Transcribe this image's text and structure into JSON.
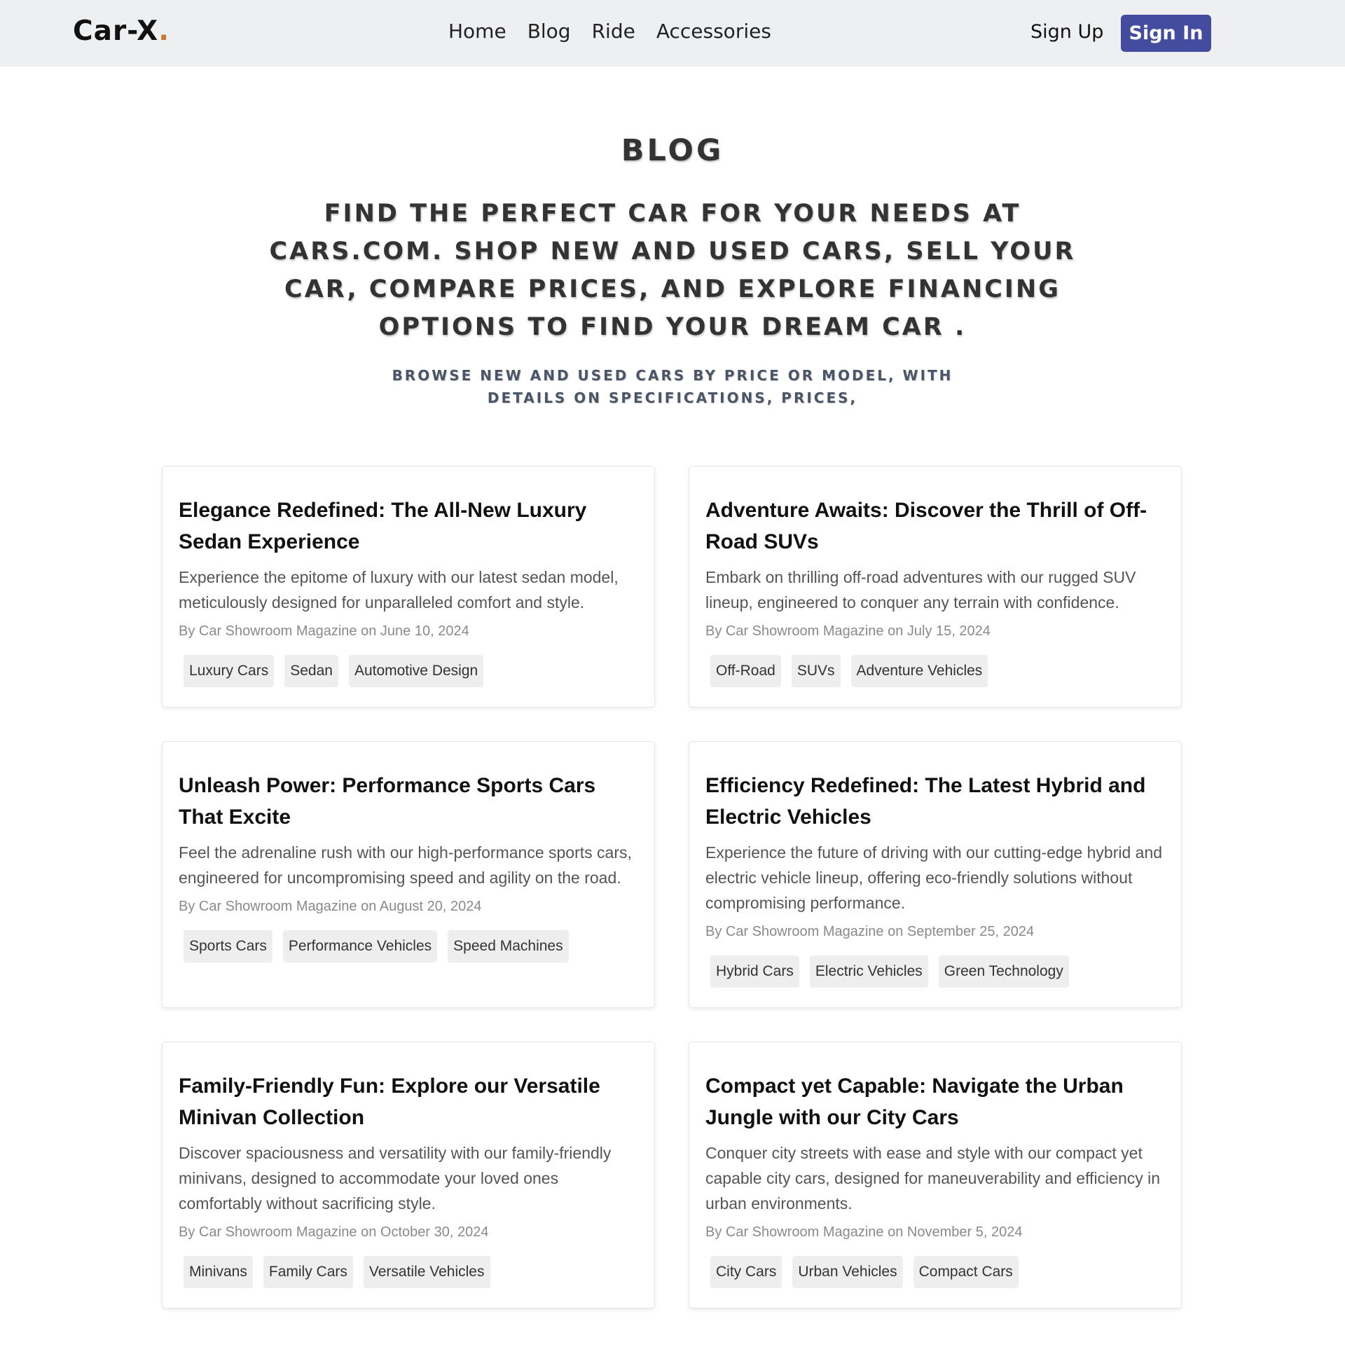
{
  "navbar": {
    "logo_text": "Car-X",
    "logo_dot": ".",
    "links": [
      "Home",
      "Blog",
      "Ride",
      "Accessories"
    ],
    "sign_up": "Sign Up",
    "sign_in": "Sign In"
  },
  "colors": {
    "accent": "#434c9e",
    "logo_dot": "#c8782f",
    "navbar_bg": "#eeeff1"
  },
  "hero": {
    "title": "BLOG",
    "subtitle": "FIND THE PERFECT CAR FOR YOUR NEEDS AT CARS.COM. SHOP NEW AND USED CARS, SELL YOUR CAR, COMPARE PRICES, AND EXPLORE FINANCING OPTIONS TO FIND YOUR DREAM CAR .",
    "small": "BROWSE NEW AND USED CARS BY PRICE OR MODEL, WITH DETAILS ON SPECIFICATIONS, PRICES,"
  },
  "posts": [
    {
      "title": "Elegance Redefined: The All-New Luxury Sedan Experience",
      "excerpt": "Experience the epitome of luxury with our latest sedan model, meticulously designed for unparalleled comfort and style.",
      "meta": "By Car Showroom Magazine on June 10, 2024",
      "tags": [
        "Luxury Cars",
        "Sedan",
        "Automotive Design"
      ]
    },
    {
      "title": "Adventure Awaits: Discover the Thrill of Off-Road SUVs",
      "excerpt": "Embark on thrilling off-road adventures with our rugged SUV lineup, engineered to conquer any terrain with confidence.",
      "meta": "By Car Showroom Magazine on July 15, 2024",
      "tags": [
        "Off-Road",
        "SUVs",
        "Adventure Vehicles"
      ]
    },
    {
      "title": "Unleash Power: Performance Sports Cars That Excite",
      "excerpt": "Feel the adrenaline rush with our high-performance sports cars, engineered for uncompromising speed and agility on the road.",
      "meta": "By Car Showroom Magazine on August 20, 2024",
      "tags": [
        "Sports Cars",
        "Performance Vehicles",
        "Speed Machines"
      ]
    },
    {
      "title": "Efficiency Redefined: The Latest Hybrid and Electric Vehicles",
      "excerpt": "Experience the future of driving with our cutting-edge hybrid and electric vehicle lineup, offering eco-friendly solutions without compromising performance.",
      "meta": "By Car Showroom Magazine on September 25, 2024",
      "tags": [
        "Hybrid Cars",
        "Electric Vehicles",
        "Green Technology"
      ]
    },
    {
      "title": "Family-Friendly Fun: Explore our Versatile Minivan Collection",
      "excerpt": "Discover spaciousness and versatility with our family-friendly minivans, designed to accommodate your loved ones comfortably without sacrificing style.",
      "meta": "By Car Showroom Magazine on October 30, 2024",
      "tags": [
        "Minivans",
        "Family Cars",
        "Versatile Vehicles"
      ]
    },
    {
      "title": "Compact yet Capable: Navigate the Urban Jungle with our City Cars",
      "excerpt": "Conquer city streets with ease and style with our compact yet capable city cars, designed for maneuverability and efficiency in urban environments.",
      "meta": "By Car Showroom Magazine on November 5, 2024",
      "tags": [
        "City Cars",
        "Urban Vehicles",
        "Compact Cars"
      ]
    }
  ]
}
